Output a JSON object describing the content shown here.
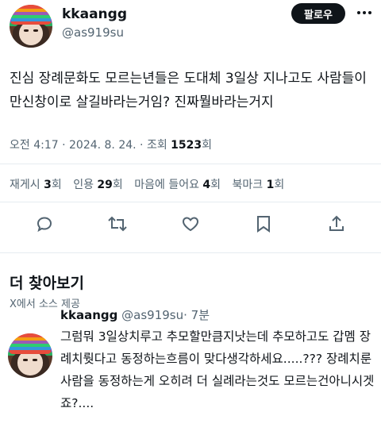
{
  "tweet": {
    "display_name": "kkaangg",
    "handle": "@as919su",
    "follow_label": "팔로우",
    "text": "진심 장례문화도 모르는년들은 도대체 3일상 지나고도 사람들이 만신창이로 살길바라는거임? 진짜뭘바라는거지",
    "meta_time": "오전 4:17 · 2024. 8. 24. · 조회 ",
    "meta_views": "1523",
    "meta_views_unit": "회"
  },
  "stats": {
    "retweets_label": "재게시 ",
    "retweets": "3",
    "retweets_unit": "회",
    "quotes_label": "인용 ",
    "quotes": "29",
    "quotes_unit": "회",
    "likes_label": "마음에 들어요 ",
    "likes": "4",
    "likes_unit": "회",
    "bookmarks_label": "북마크 ",
    "bookmarks": "1",
    "bookmarks_unit": "회"
  },
  "actions": {
    "icons": [
      "reply-icon",
      "retweet-icon",
      "like-icon",
      "bookmark-icon",
      "share-icon"
    ]
  },
  "more": {
    "title": "더 찾아보기",
    "subtitle": "X에서 소스 제공"
  },
  "reply": {
    "display_name": "kkaangg",
    "handle": "@as919su",
    "time": "· 7분",
    "text": "그럼뭐 3일상치루고 추모할만큼지낫는데 추모하고도 갑멤 장례치뤗다고 동정하는흐름이 맞다생각하세요.....??? 장례치룬사람을 동정하는게 오히려 더 실례라는것도 모르는건아니시겟죠?...."
  },
  "colors": {
    "text": "#0f1419",
    "secondary": "#536471",
    "button_bg": "#0f1419",
    "divider": "#e6ecf0"
  }
}
